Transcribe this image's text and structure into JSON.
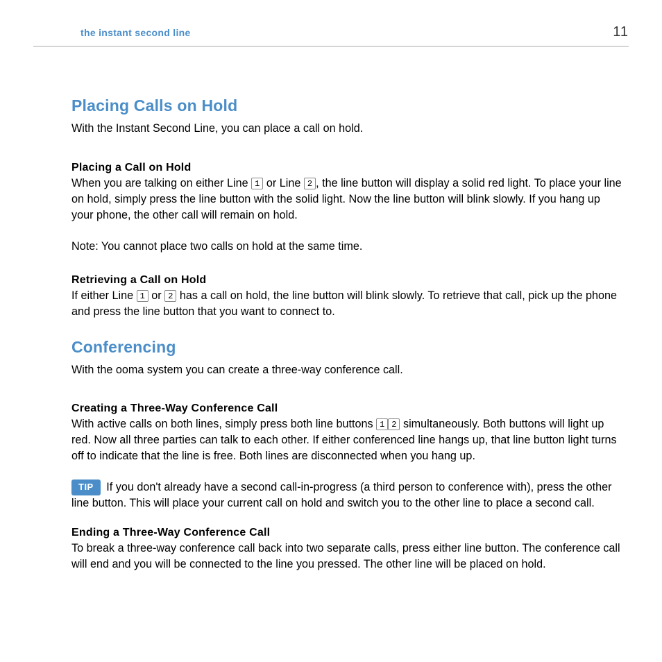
{
  "header": {
    "title": "the instant second line",
    "page": "11"
  },
  "s1": {
    "heading": "Placing Calls on Hold",
    "intro": "With the Instant Second Line, you can place a call on hold.",
    "sub1": "Placing a Call on Hold",
    "p1a": "When you are talking on either Line ",
    "btn1a": "1",
    "p1b": " or Line ",
    "btn1b": "2",
    "p1c": ", the line button will display a solid red light. To place your line on hold, simply press the line button with the solid light. Now the line button will blink slowly. If you hang up your phone, the other call will remain on hold.",
    "note": "Note: You cannot place two calls on hold at the same time.",
    "sub2": "Retrieving a Call on Hold",
    "p2a": "If either Line ",
    "btn2a": "1",
    "p2b": " or ",
    "btn2b": "2",
    "p2c": " has a call on hold, the line button will blink slowly. To retrieve that call, pick up the phone and press the line button that you want to connect to."
  },
  "s2": {
    "heading": "Conferencing",
    "intro": "With the ooma system you can create a three-way conference call.",
    "sub1": "Creating a Three-Way Conference Call",
    "p1a": "With active calls on both lines, simply press both line buttons ",
    "btn1a": "1",
    "btn1b": "2",
    "p1b": " simultaneously. Both buttons will light up red. Now all three parties can talk to each other. If either conferenced line hangs up, that line button light turns off to indicate that the line is free. Both lines are disconnected when you hang up.",
    "tip_label": "TIP",
    "tip_text": " If you don't already have a second call-in-progress (a third person to conference with), press the other line button. This will place your current call on hold and switch you to the other line to place a second call.",
    "sub2": "Ending a Three-Way Conference Call",
    "p2": "To break a three-way conference call back into two separate calls, press either line button. The conference call will end and you will be connected to the line you pressed. The other line will be placed on hold."
  }
}
